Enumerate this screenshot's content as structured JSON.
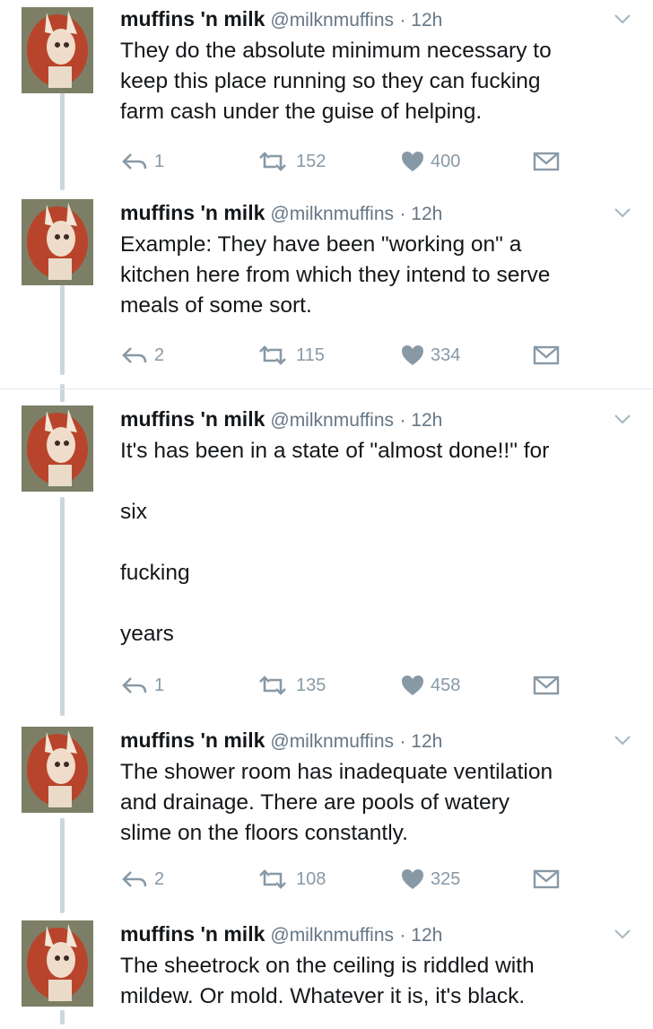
{
  "tweets": [
    {
      "name": "muffins 'n milk",
      "handle": "@milknmuffins",
      "time": "· 12h",
      "text": "They do the absolute minimum necessary to\nkeep this place running so they can fucking\nfarm cash under the guise of helping.",
      "replies": "1",
      "retweets": "152",
      "likes": "400"
    },
    {
      "name": "muffins 'n milk",
      "handle": "@milknmuffins",
      "time": "· 12h",
      "text": "Example: They have been \"working on\" a\nkitchen here from which they intend to serve\nmeals of some sort.",
      "replies": "2",
      "retweets": "115",
      "likes": "334"
    },
    {
      "name": "muffins 'n milk",
      "handle": "@milknmuffins",
      "time": "· 12h",
      "text": "It's has been in a state of \"almost done!!\" for\n\nsix\n\nfucking\n\nyears",
      "replies": "1",
      "retweets": "135",
      "likes": "458"
    },
    {
      "name": "muffins 'n milk",
      "handle": "@milknmuffins",
      "time": "· 12h",
      "text": "The shower room has inadequate ventilation\nand drainage. There are pools of watery\nslime on the floors constantly.",
      "replies": "2",
      "retweets": "108",
      "likes": "325"
    },
    {
      "name": "muffins 'n milk",
      "handle": "@milknmuffins",
      "time": "· 12h",
      "text": "The sheetrock on the ceiling is riddled with\nmildew. Or mold. Whatever it is, it's black."
    }
  ],
  "icons": {
    "reply": "reply-icon",
    "retweet": "retweet-icon",
    "like": "heart-icon",
    "message": "envelope-icon",
    "more": "chevron-down-icon",
    "avatar": "avatar"
  },
  "colors": {
    "text": "#14171a",
    "muted": "#8899a6",
    "handle": "#657786",
    "thread_line": "#ccd6dd",
    "divider": "#e1e8ed"
  }
}
